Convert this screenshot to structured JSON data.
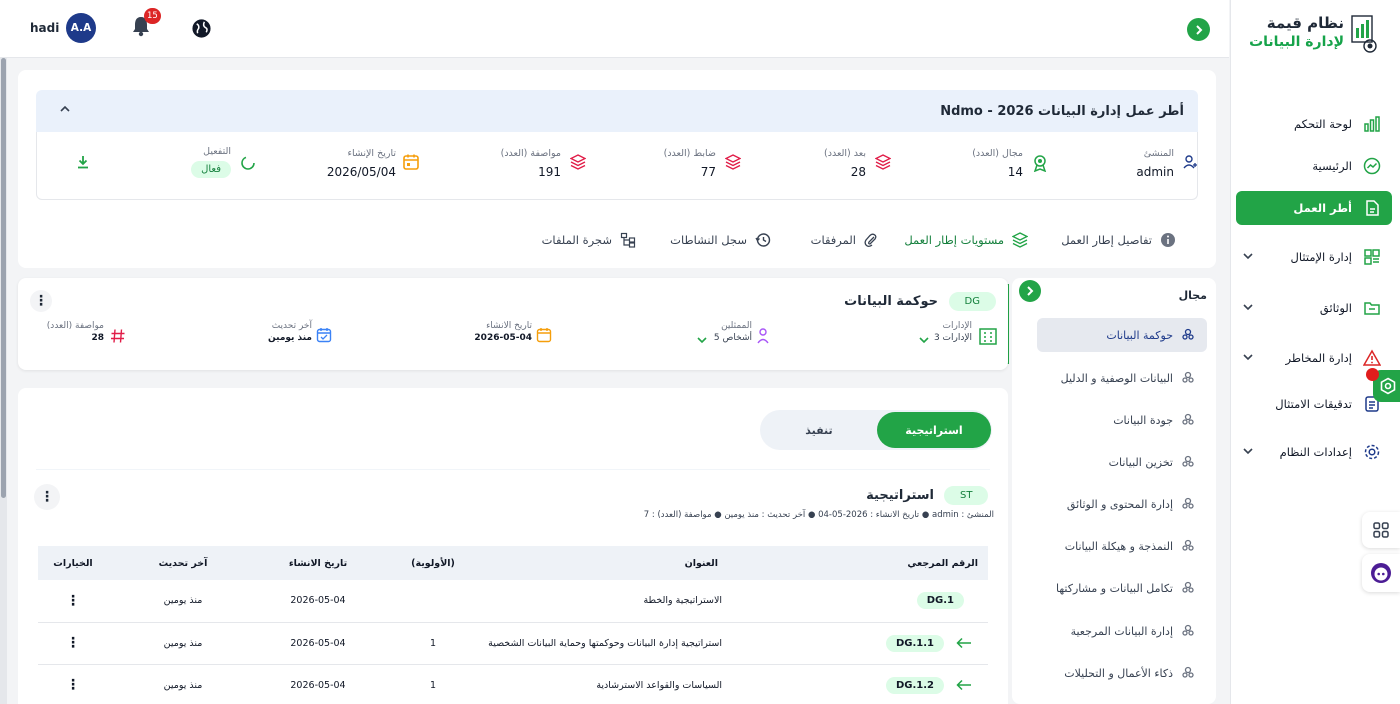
{
  "brand": {
    "line1": "نظام قيمة",
    "line2": "لإدارة البيانات"
  },
  "topbar": {
    "user_name": "hadi",
    "avatar_initials": "A.A",
    "notification_count": "15"
  },
  "sidebar": {
    "items": [
      {
        "label": "لوحة التحكم",
        "icon": "chart-icon"
      },
      {
        "label": "الرئيسية",
        "icon": "trend-icon"
      },
      {
        "label": "أطر العمل",
        "icon": "document-icon",
        "active": true
      },
      {
        "label": "إدارة الإمتثال",
        "icon": "grid-icon"
      },
      {
        "label": "الوثائق",
        "icon": "folder-icon"
      },
      {
        "label": "إدارة المخاطر",
        "icon": "warning-icon"
      },
      {
        "label": "تدقيقات الامتثال",
        "icon": "audit-icon"
      },
      {
        "label": "إعدادات النظام",
        "icon": "gear-icon"
      }
    ]
  },
  "framework": {
    "title": "Ndmo - أطر عمل إدارة البيانات 2026",
    "stats": {
      "creator_label": "المنشئ",
      "creator_value": "admin",
      "domains_label": "مجال (العدد)",
      "domains_value": "14",
      "dimensions_label": "بعد (العدد)",
      "dimensions_value": "28",
      "controls_label": "ضابط (العدد)",
      "controls_value": "77",
      "specs_label": "مواصفة (العدد)",
      "specs_value": "191",
      "created_label": "تاريخ الإنشاء",
      "created_value": "2026/05/04",
      "activation_label": "التفعيل",
      "activation_value": "فعال"
    },
    "tabs": [
      "تفاصيل إطار العمل",
      "مستويات إطار العمل",
      "المرفقات",
      "سجل النشاطات",
      "شجرة الملفات"
    ]
  },
  "domains": {
    "heading": "مجال",
    "items": [
      "حوكمة البيانات",
      "البيانات الوصفية و الدليل",
      "جودة البيانات",
      "تخزين البيانات",
      "إدارة المحتوى و الوثائق",
      "النمذجة و هيكلة البيانات",
      "تكامل البيانات و مشاركتها",
      "إدارة البيانات المرجعية",
      "ذكاء الأعمال و التحليلات"
    ]
  },
  "domain_card": {
    "code": "DG",
    "name": "حوكمة البيانات",
    "departments_label": "الإدارات",
    "departments_value": "3 الإدارات",
    "reps_label": "الممثلين",
    "reps_value": "5 أشخاص",
    "created_label": "تاريخ الانشاء",
    "created_value": "2026-05-04",
    "updated_label": "آخر تحديث",
    "updated_value": "منذ يومين",
    "specs_label": "مواصفة (العدد)",
    "specs_value": "28"
  },
  "toggle": {
    "strategy": "استراتيجية",
    "execution": "تنفيذ"
  },
  "strategy": {
    "code": "ST",
    "name": "استراتيجية",
    "meta": "المنشئ : admin  ●  تاريخ الانشاء : 2026-05-04  ●  آخر تحديث : منذ يومين  ●  مواصفة (العدد) : 7"
  },
  "table": {
    "headers": {
      "ref": "الرقم المرجعي",
      "title": "العنوان",
      "priority": "(الأولوية)",
      "created": "تاريخ الانشاء",
      "updated": "آخر تحديث",
      "options": "الخيارات"
    },
    "rows": [
      {
        "ref": "DG.1",
        "title": "الاستراتيجية والخطة",
        "priority": "",
        "created": "2026-05-04",
        "updated": "منذ يومين"
      },
      {
        "ref": "DG.1.1",
        "title": "استراتيجية إدارة البيانات وحوكمتها وحماية البيانات الشخصية",
        "priority": "1",
        "created": "2026-05-04",
        "updated": "منذ يومين"
      },
      {
        "ref": "DG.1.2",
        "title": "السياسات والقواعد الاسترشادية",
        "priority": "1",
        "created": "2026-05-04",
        "updated": "منذ يومين"
      }
    ]
  },
  "colors": {
    "accent": "#22a447",
    "danger": "#dc2626",
    "navy": "#1e3a8a"
  }
}
